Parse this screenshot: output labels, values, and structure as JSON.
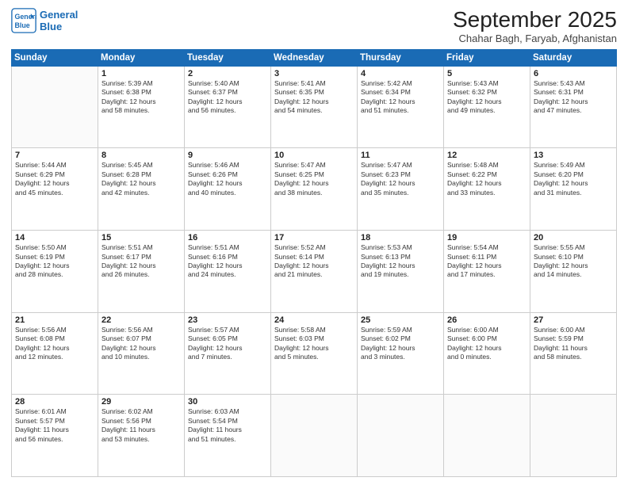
{
  "header": {
    "logo_line1": "General",
    "logo_line2": "Blue",
    "month_title": "September 2025",
    "location": "Chahar Bagh, Faryab, Afghanistan"
  },
  "days_of_week": [
    "Sunday",
    "Monday",
    "Tuesday",
    "Wednesday",
    "Thursday",
    "Friday",
    "Saturday"
  ],
  "weeks": [
    [
      {
        "day": "",
        "info": ""
      },
      {
        "day": "1",
        "info": "Sunrise: 5:39 AM\nSunset: 6:38 PM\nDaylight: 12 hours\nand 58 minutes."
      },
      {
        "day": "2",
        "info": "Sunrise: 5:40 AM\nSunset: 6:37 PM\nDaylight: 12 hours\nand 56 minutes."
      },
      {
        "day": "3",
        "info": "Sunrise: 5:41 AM\nSunset: 6:35 PM\nDaylight: 12 hours\nand 54 minutes."
      },
      {
        "day": "4",
        "info": "Sunrise: 5:42 AM\nSunset: 6:34 PM\nDaylight: 12 hours\nand 51 minutes."
      },
      {
        "day": "5",
        "info": "Sunrise: 5:43 AM\nSunset: 6:32 PM\nDaylight: 12 hours\nand 49 minutes."
      },
      {
        "day": "6",
        "info": "Sunrise: 5:43 AM\nSunset: 6:31 PM\nDaylight: 12 hours\nand 47 minutes."
      }
    ],
    [
      {
        "day": "7",
        "info": "Sunrise: 5:44 AM\nSunset: 6:29 PM\nDaylight: 12 hours\nand 45 minutes."
      },
      {
        "day": "8",
        "info": "Sunrise: 5:45 AM\nSunset: 6:28 PM\nDaylight: 12 hours\nand 42 minutes."
      },
      {
        "day": "9",
        "info": "Sunrise: 5:46 AM\nSunset: 6:26 PM\nDaylight: 12 hours\nand 40 minutes."
      },
      {
        "day": "10",
        "info": "Sunrise: 5:47 AM\nSunset: 6:25 PM\nDaylight: 12 hours\nand 38 minutes."
      },
      {
        "day": "11",
        "info": "Sunrise: 5:47 AM\nSunset: 6:23 PM\nDaylight: 12 hours\nand 35 minutes."
      },
      {
        "day": "12",
        "info": "Sunrise: 5:48 AM\nSunset: 6:22 PM\nDaylight: 12 hours\nand 33 minutes."
      },
      {
        "day": "13",
        "info": "Sunrise: 5:49 AM\nSunset: 6:20 PM\nDaylight: 12 hours\nand 31 minutes."
      }
    ],
    [
      {
        "day": "14",
        "info": "Sunrise: 5:50 AM\nSunset: 6:19 PM\nDaylight: 12 hours\nand 28 minutes."
      },
      {
        "day": "15",
        "info": "Sunrise: 5:51 AM\nSunset: 6:17 PM\nDaylight: 12 hours\nand 26 minutes."
      },
      {
        "day": "16",
        "info": "Sunrise: 5:51 AM\nSunset: 6:16 PM\nDaylight: 12 hours\nand 24 minutes."
      },
      {
        "day": "17",
        "info": "Sunrise: 5:52 AM\nSunset: 6:14 PM\nDaylight: 12 hours\nand 21 minutes."
      },
      {
        "day": "18",
        "info": "Sunrise: 5:53 AM\nSunset: 6:13 PM\nDaylight: 12 hours\nand 19 minutes."
      },
      {
        "day": "19",
        "info": "Sunrise: 5:54 AM\nSunset: 6:11 PM\nDaylight: 12 hours\nand 17 minutes."
      },
      {
        "day": "20",
        "info": "Sunrise: 5:55 AM\nSunset: 6:10 PM\nDaylight: 12 hours\nand 14 minutes."
      }
    ],
    [
      {
        "day": "21",
        "info": "Sunrise: 5:56 AM\nSunset: 6:08 PM\nDaylight: 12 hours\nand 12 minutes."
      },
      {
        "day": "22",
        "info": "Sunrise: 5:56 AM\nSunset: 6:07 PM\nDaylight: 12 hours\nand 10 minutes."
      },
      {
        "day": "23",
        "info": "Sunrise: 5:57 AM\nSunset: 6:05 PM\nDaylight: 12 hours\nand 7 minutes."
      },
      {
        "day": "24",
        "info": "Sunrise: 5:58 AM\nSunset: 6:03 PM\nDaylight: 12 hours\nand 5 minutes."
      },
      {
        "day": "25",
        "info": "Sunrise: 5:59 AM\nSunset: 6:02 PM\nDaylight: 12 hours\nand 3 minutes."
      },
      {
        "day": "26",
        "info": "Sunrise: 6:00 AM\nSunset: 6:00 PM\nDaylight: 12 hours\nand 0 minutes."
      },
      {
        "day": "27",
        "info": "Sunrise: 6:00 AM\nSunset: 5:59 PM\nDaylight: 11 hours\nand 58 minutes."
      }
    ],
    [
      {
        "day": "28",
        "info": "Sunrise: 6:01 AM\nSunset: 5:57 PM\nDaylight: 11 hours\nand 56 minutes."
      },
      {
        "day": "29",
        "info": "Sunrise: 6:02 AM\nSunset: 5:56 PM\nDaylight: 11 hours\nand 53 minutes."
      },
      {
        "day": "30",
        "info": "Sunrise: 6:03 AM\nSunset: 5:54 PM\nDaylight: 11 hours\nand 51 minutes."
      },
      {
        "day": "",
        "info": ""
      },
      {
        "day": "",
        "info": ""
      },
      {
        "day": "",
        "info": ""
      },
      {
        "day": "",
        "info": ""
      }
    ]
  ]
}
